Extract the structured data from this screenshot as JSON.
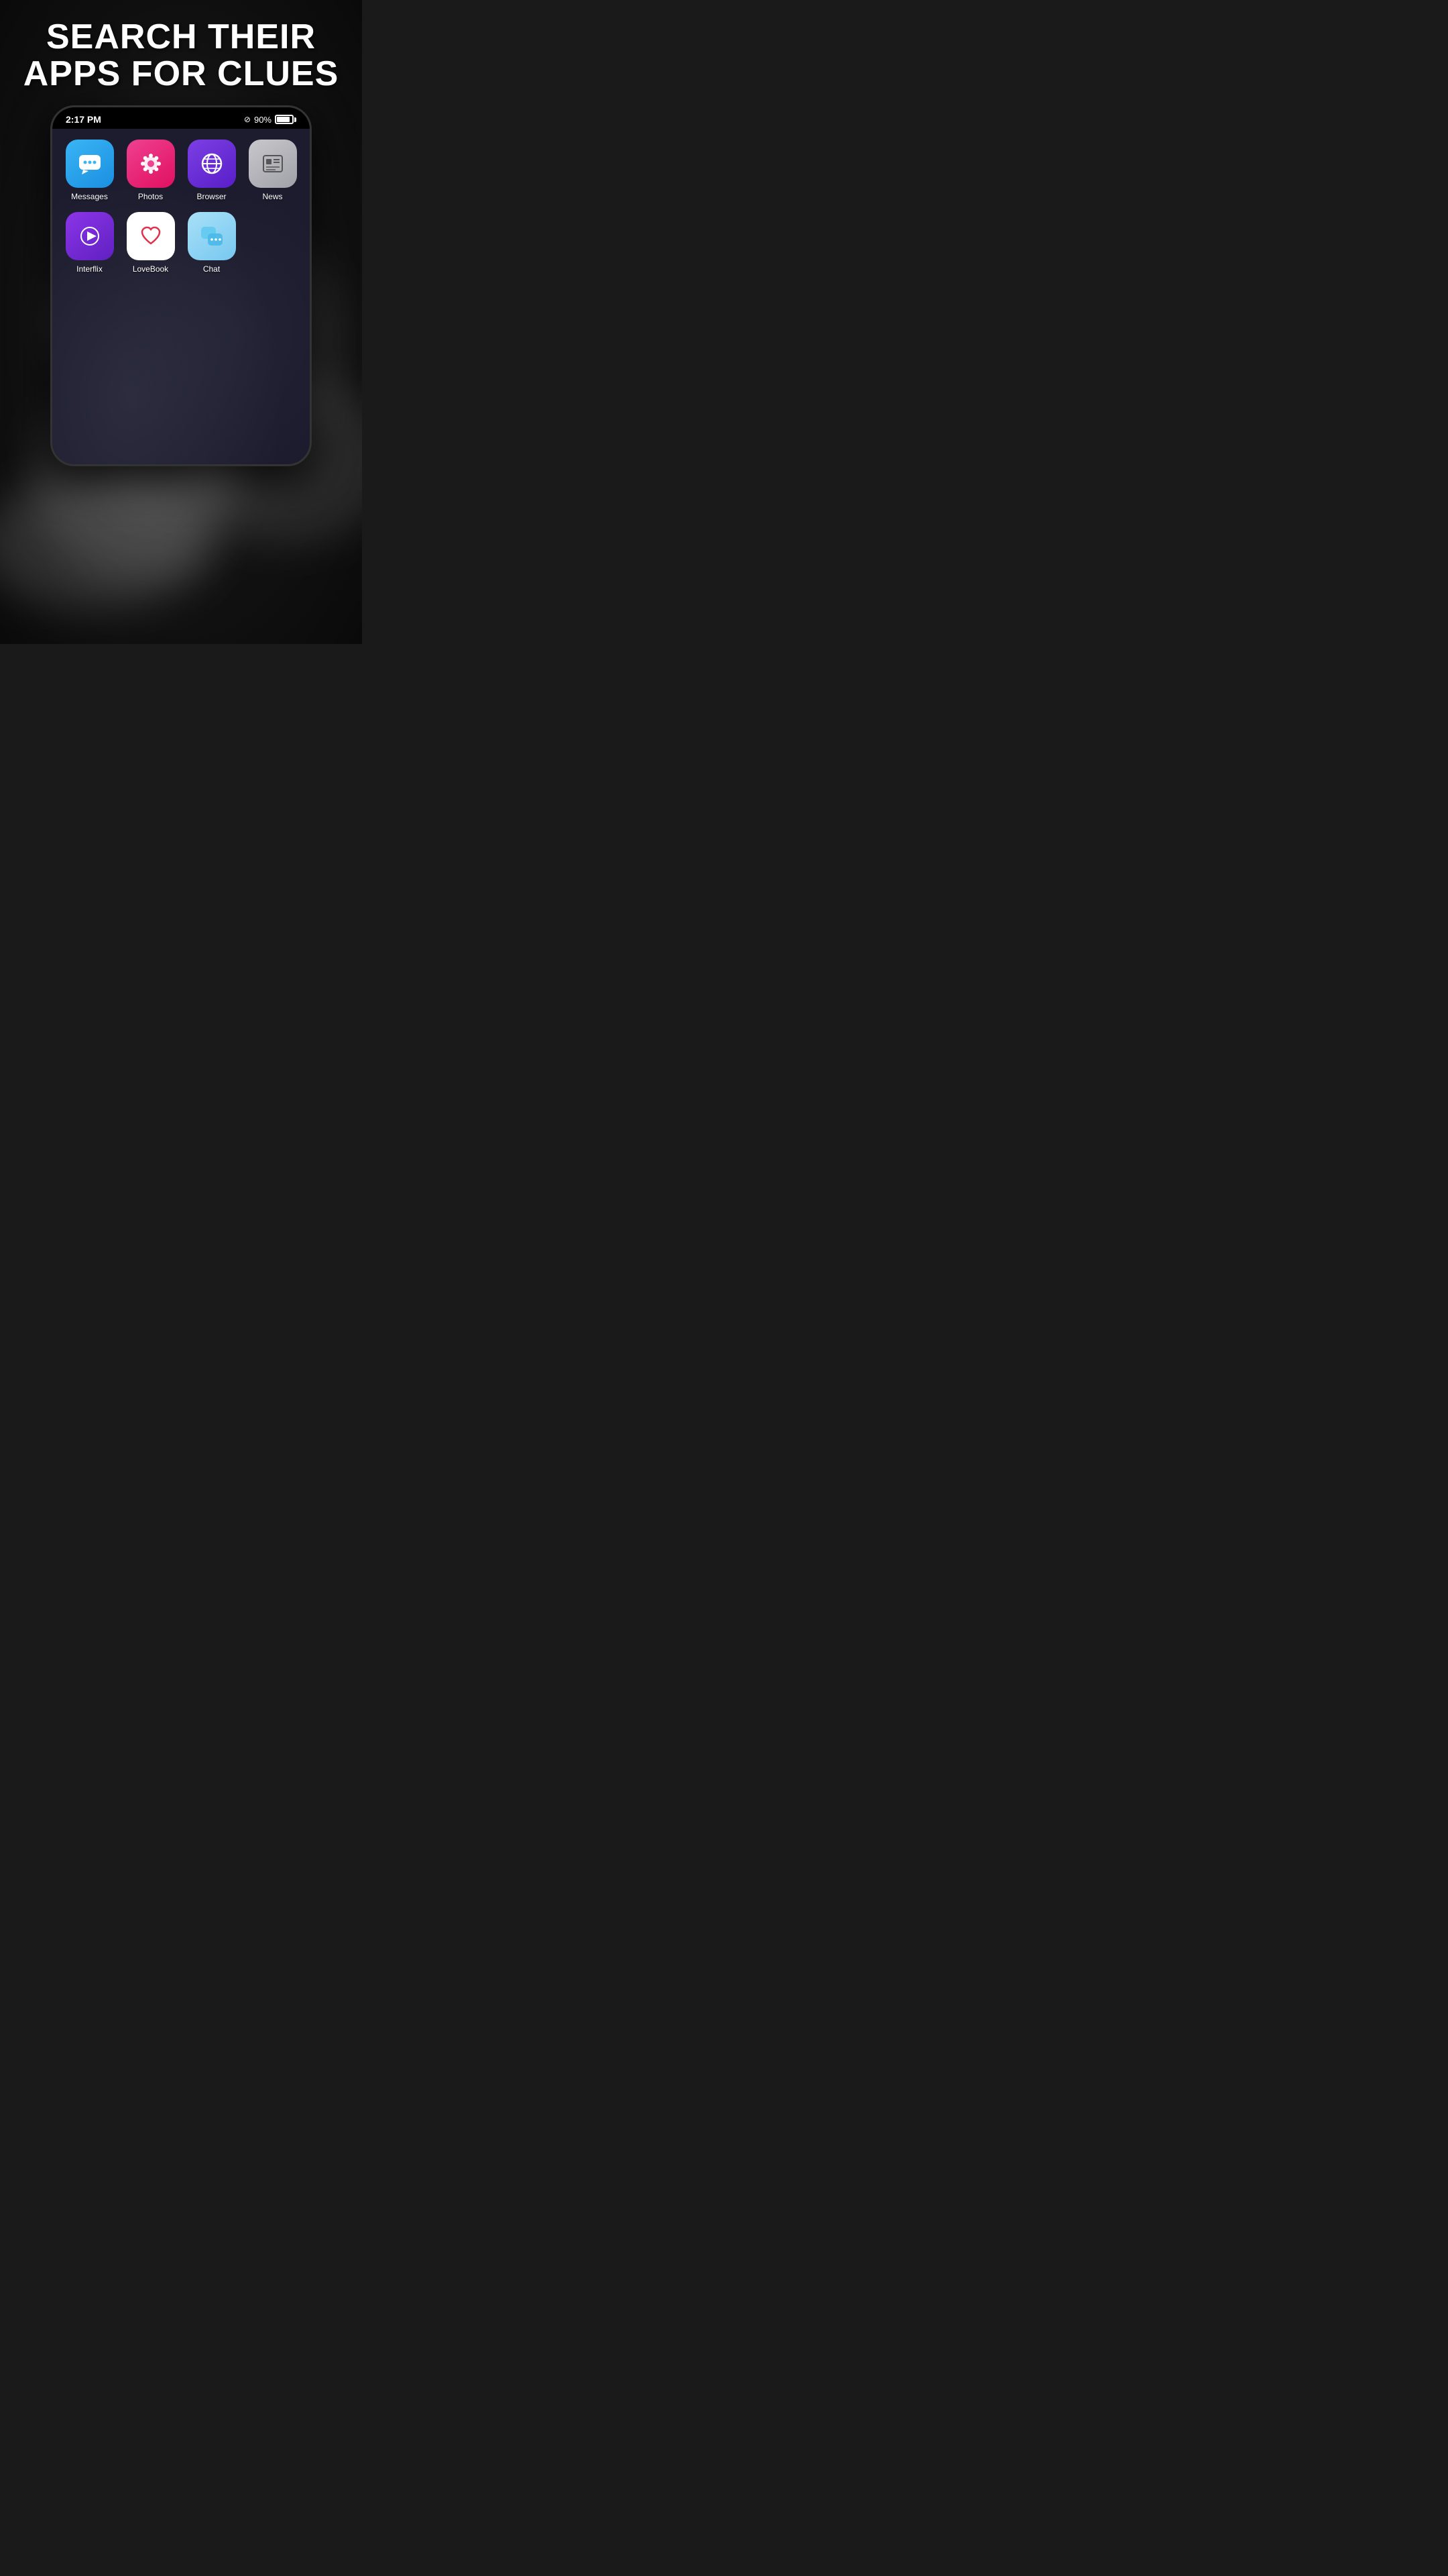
{
  "page": {
    "headline_line1": "SEARCH THEIR",
    "headline_line2": "APPS FOR CLUES"
  },
  "status_bar": {
    "time": "2:17 PM",
    "battery_percent": "90%"
  },
  "apps_row1": [
    {
      "id": "messages",
      "label": "Messages",
      "icon_type": "messages"
    },
    {
      "id": "photos",
      "label": "Photos",
      "icon_type": "photos"
    },
    {
      "id": "browser",
      "label": "Browser",
      "icon_type": "browser"
    },
    {
      "id": "news",
      "label": "News",
      "icon_type": "news"
    }
  ],
  "apps_row2": [
    {
      "id": "interflix",
      "label": "Interflix",
      "icon_type": "interflix"
    },
    {
      "id": "lovebook",
      "label": "LoveBook",
      "icon_type": "lovebook"
    },
    {
      "id": "chat",
      "label": "Chat",
      "icon_type": "chat"
    },
    {
      "id": "empty",
      "label": "",
      "icon_type": "empty"
    }
  ]
}
